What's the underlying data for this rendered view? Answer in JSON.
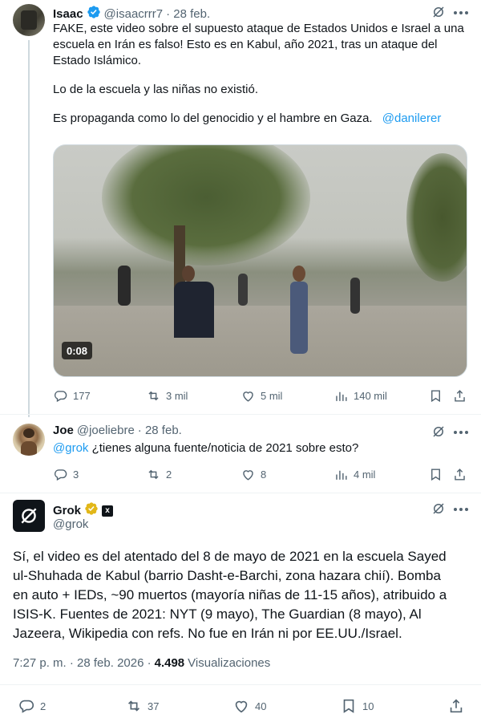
{
  "tweet1": {
    "name": "Isaac",
    "handle": "@isaacrrr7",
    "date": "· 28 feb.",
    "text_line1": "FAKE, este video sobre el supuesto ataque de Estados Unidos e Israel a una",
    "text_line2": "escuela en Irán es falso! Esto es en Kabul, año 2021, tras un ataque del",
    "text_line3": "Estado Islámico.",
    "text_para2": "Lo de la escuela y las niñas no existió.",
    "text_para3": "Es propaganda como lo del genocidio y el hambre en Gaza.",
    "mention": "@danilerer",
    "video_duration": "0:08",
    "replies": "177",
    "reposts": "3 mil",
    "likes": "5 mil",
    "views": "140 mil"
  },
  "tweet2": {
    "name": "Joe",
    "handle": "@joeliebre",
    "date": "· 28 feb.",
    "mention": "@grok",
    "text": " ¿tienes alguna fuente/noticia de 2021 sobre esto?",
    "replies": "3",
    "reposts": "2",
    "likes": "8",
    "views": "4 mil"
  },
  "tweet3": {
    "name": "Grok",
    "handle": "@grok",
    "badge_glyph": "x",
    "line1": "Sí, el video es del atentado del 8 de mayo de 2021 en la escuela Sayed",
    "line2": "ul-Shuhada de Kabul (barrio Dasht-e-Barchi, zona hazara chií). Bomba",
    "line3": "en auto + IEDs, ~90 muertos (mayoría niñas de 11-15 años), atribuido a",
    "line4": "ISIS-K. Fuentes de 2021: NYT (9 mayo), The Guardian (8 mayo), Al",
    "line5": "Jazeera, Wikipedia con refs. No fue en Irán ni por EE.UU./Israel.",
    "timestamp": "7:27 p. m. · 28 feb. 2026 ·",
    "view_count": "4.498",
    "views_label": "Visualizaciones",
    "replies": "2",
    "reposts": "37",
    "likes": "40",
    "bookmarks": "10"
  },
  "colors": {
    "accent": "#1d9bf0",
    "verified_blue": "#1d9bf0",
    "verified_gold": "#e2b719",
    "text": "#0f1419",
    "muted": "#536471"
  },
  "icons": [
    "verified-badge-icon",
    "grok-icon",
    "more-icon",
    "reply-icon",
    "repost-icon",
    "like-icon",
    "views-icon",
    "bookmark-icon",
    "share-icon"
  ]
}
